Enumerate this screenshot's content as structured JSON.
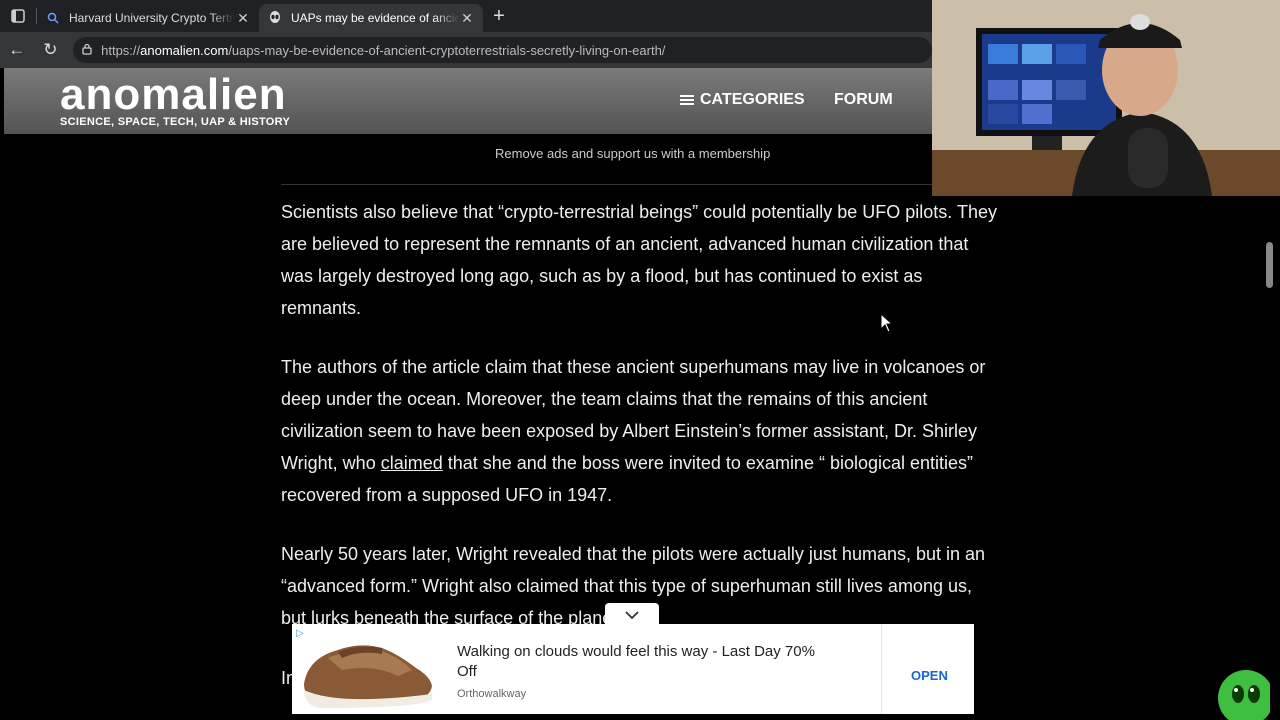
{
  "browser": {
    "tabs": [
      {
        "title": "Harvard University Crypto Tertrest",
        "active": false,
        "favicon": "search-icon"
      },
      {
        "title": "UAPs may be evidence of ancient",
        "active": true,
        "favicon": "alien-icon"
      }
    ],
    "new_tab_symbol": "+",
    "url_scheme": "https://",
    "url_host": "anomalien.com",
    "url_path": "/uaps-may-be-evidence-of-ancient-cryptoterrestrials-secretly-living-on-earth/"
  },
  "site": {
    "logo": "anomalien",
    "tagline": "SCIENCE, SPACE, TECH, UAP & HISTORY",
    "nav": {
      "categories": "CATEGORIES",
      "forum": "FORUM"
    },
    "promo": "Remove ads and support us with a membership",
    "accent": "#3b9cd8"
  },
  "article": {
    "p1": "Scientists also believe that “crypto-terrestrial beings” could potentially be UFO pilots. They are believed to represent the remnants of an ancient, advanced human civilization that was largely destroyed long ago, such as by a flood, but has continued to exist as remnants.",
    "p2_before": "The authors of the article claim that these ancient superhumans may live in volcanoes or deep under the ocean. Moreover, the team claims that the remains of this ancient civilization seem to have been exposed by Albert Einstein’s former assistant, Dr. Shirley Wright, who ",
    "p2_link": "claimed",
    "p2_after": " that she and the boss were invited to examine “ biological entities” recovered from a supposed UFO in 1947.",
    "p3": "Nearly 50 years later, Wright revealed that the pilots were actually just humans, but in an “advanced form.” Wright also claimed that this type of superhuman still lives among us, but lurks beneath the surface of the planet.",
    "p4_start": "In"
  },
  "ad": {
    "title": "Walking on clouds would feel this way - Last Day 70% Off",
    "source": "Orthowalkway",
    "cta": "OPEN"
  }
}
